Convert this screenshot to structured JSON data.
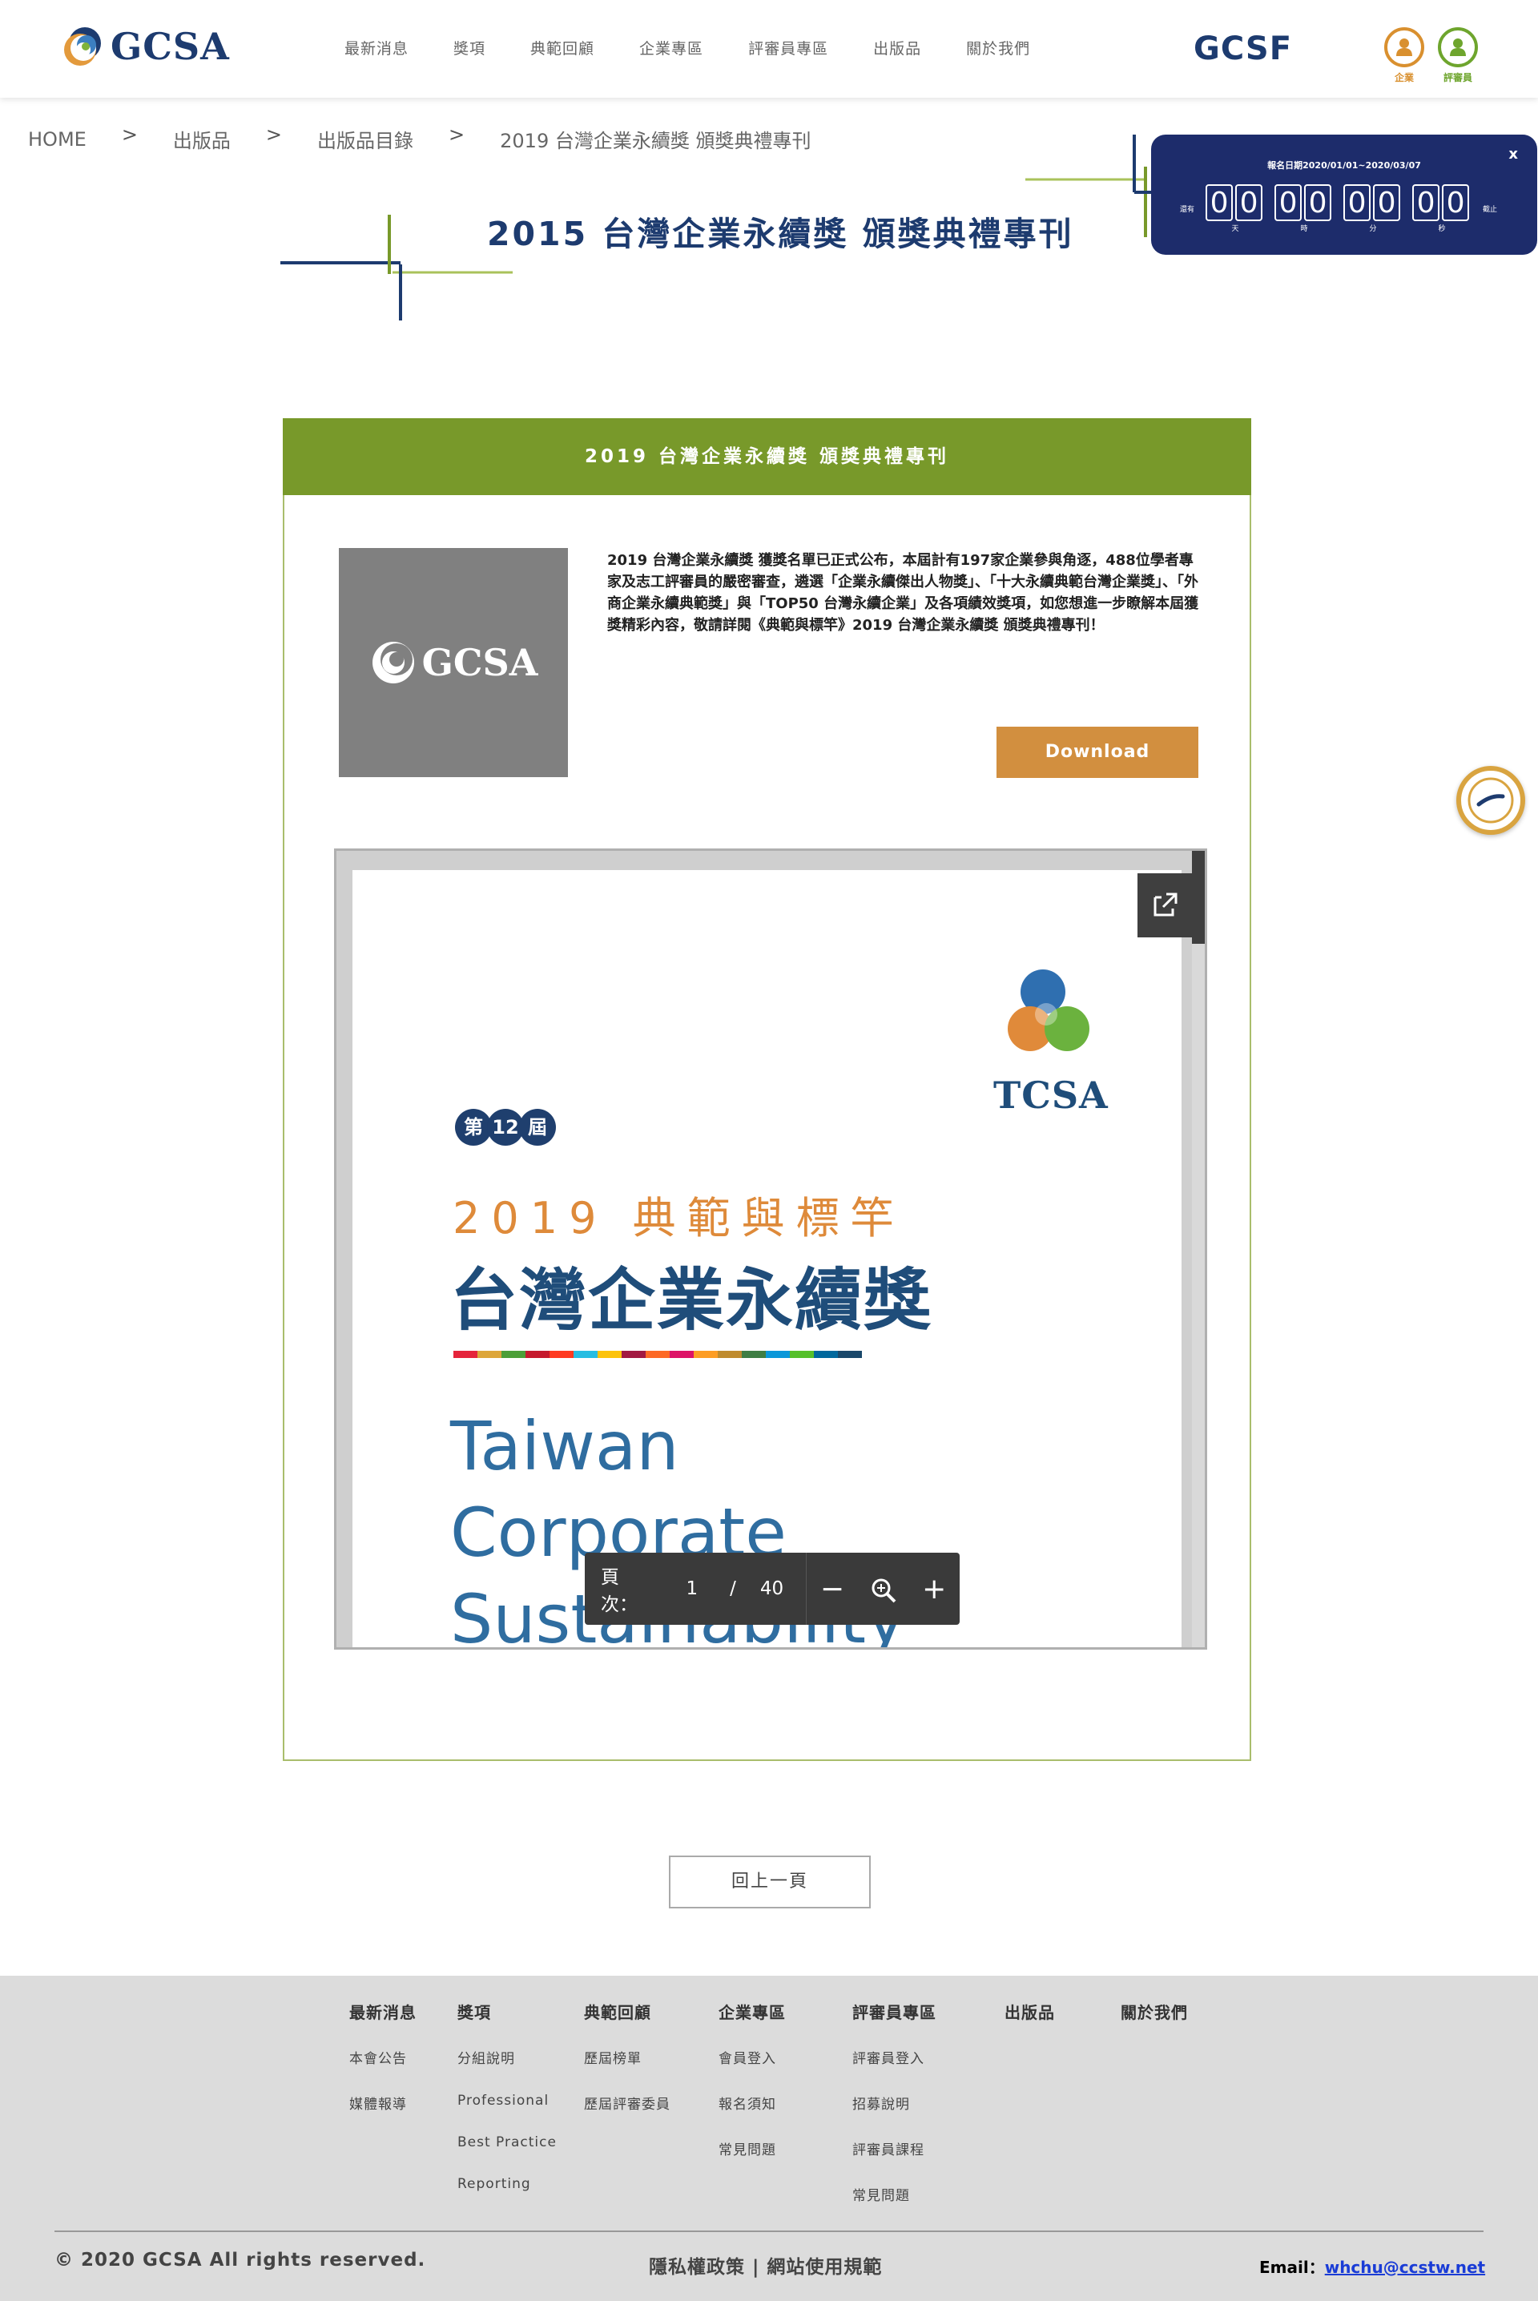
{
  "header": {
    "logo_text": "GCSA",
    "nav": [
      "最新消息",
      "獎項",
      "典範回顧",
      "企業專區",
      "評審員專區",
      "出版品",
      "關於我們"
    ],
    "gcsf_label": "GCSF",
    "user_buttons": [
      {
        "label": "企業",
        "color": "#d9902f"
      },
      {
        "label": "評審員",
        "color": "#6ea52d"
      }
    ]
  },
  "breadcrumb": {
    "items": [
      "HOME",
      "出版品",
      "出版品目錄",
      "2019 台灣企業永續獎 頒獎典禮專刊"
    ],
    "separator": ">"
  },
  "page_title": "2015 台灣企業永續獎 頒獎典禮專刊",
  "countdown": {
    "date_range": "報名日期2020/01/01~2020/03/07",
    "close_label": "x",
    "left_label": "還有",
    "right_label": "截止",
    "units": [
      {
        "digits": [
          "0",
          "0"
        ],
        "label": "天"
      },
      {
        "digits": [
          "0",
          "0"
        ],
        "label": "時"
      },
      {
        "digits": [
          "0",
          "0"
        ],
        "label": "分"
      },
      {
        "digits": [
          "0",
          "0"
        ],
        "label": "秒"
      }
    ]
  },
  "card": {
    "header": "2019 台灣企業永續獎 頒獎典禮專刊",
    "thumb_logo": "GCSA",
    "description": "2019 台灣企業永續獎 獲獎名單已正式公布，本屆計有197家企業參與角逐，488位學者專家及志工評審員的嚴密審查，遴選「企業永續傑出人物獎」、「十大永續典範台灣企業獎」、「外商企業永續典範獎」與「TOP50 台灣永續企業」及各項績效獎項，如您想進一步瞭解本屆獲獎精彩內容，敬請詳閱《典範與標竿》2019 台灣企業永續獎 頒獎典禮專刊！",
    "download_label": "Download"
  },
  "viewer": {
    "tcsa_label": "TCSA",
    "edition": [
      "第",
      "12",
      "屆"
    ],
    "year_line": "2019 典範與標竿",
    "award_title": "台灣企業永續獎",
    "strip_colors": [
      "#e5243b",
      "#dda63a",
      "#4c9f38",
      "#c5192d",
      "#ff3a21",
      "#26bde2",
      "#fcc30b",
      "#a21942",
      "#fd6925",
      "#dd1367",
      "#fd9d24",
      "#bf8b2e",
      "#3f7e44",
      "#0a97d9",
      "#56c02b",
      "#00689d",
      "#19486a"
    ],
    "en_title": [
      "Taiwan",
      "Corporate",
      "Sustainability"
    ],
    "toolbar": {
      "page_label": "頁次：",
      "current_page": "1",
      "slash": "/",
      "total_pages": "40",
      "zoom_out": "−",
      "zoom_in": "+"
    }
  },
  "back_button": "回上一頁",
  "footer": {
    "columns": [
      {
        "heading": "最新消息",
        "items": [
          "本會公告",
          "媒體報導"
        ]
      },
      {
        "heading": "獎項",
        "items": [
          "分組說明",
          "Professional",
          "Best Practice",
          "Reporting"
        ]
      },
      {
        "heading": "典範回顧",
        "items": [
          "歷屆榜單",
          "歷屆評審委員"
        ]
      },
      {
        "heading": "企業專區",
        "items": [
          "會員登入",
          "報名須知",
          "常見問題"
        ]
      },
      {
        "heading": "評審員專區",
        "items": [
          "評審員登入",
          "招募說明",
          "評審員課程",
          "常見問題"
        ]
      },
      {
        "heading": "出版品",
        "items": []
      },
      {
        "heading": "關於我們",
        "items": []
      }
    ],
    "copyright": "© 2020 GCSA All rights reserved.",
    "policy": "隱私權政策 | 網站使用規範",
    "email_label": "Email：",
    "email": "whchu@ccstw.net"
  },
  "colors": {
    "navy": "#1d3b6f",
    "green": "#78992a",
    "orange": "#d28f3f",
    "countdown_bg": "#1d2c6b"
  }
}
